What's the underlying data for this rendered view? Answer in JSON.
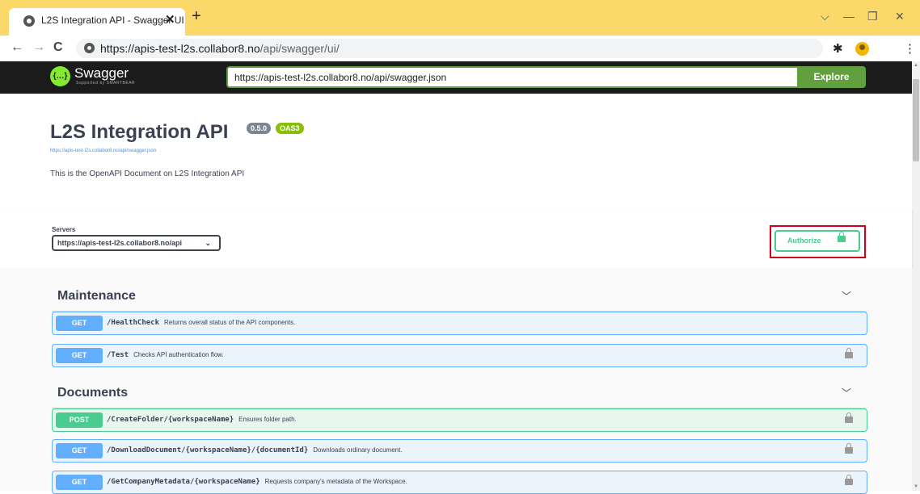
{
  "browser": {
    "tab_title": "L2S Integration API - Swagger UI",
    "tab_close": "✕",
    "new_tab": "+",
    "url_host": "https://apis-test-l2s.collabor8.no",
    "url_path": "/api/swagger/ui/",
    "back": "←",
    "forward": "→",
    "reload": "C",
    "window_dropdown": "⌵",
    "minimize": "—",
    "restore": "❐",
    "close": "✕",
    "extensions": "✱",
    "sidepanel": "◧",
    "menu": "⋮"
  },
  "topbar": {
    "logo_mark": "{…}",
    "logo_text": "Swagger",
    "logo_sub": "Supported by SMARTBEAR",
    "spec_url": "https://apis-test-l2s.collabor8.no/api/swagger.json",
    "explore_label": "Explore"
  },
  "info": {
    "title": "L2S Integration API",
    "version": "0.5.0",
    "oas": "OAS3",
    "link": "https://apis-test-l2s.collabor8.no/api/swagger.json",
    "description": "This is the OpenAPI Document on L2S Integration API"
  },
  "scheme": {
    "servers_label": "Servers",
    "selected_server": "https://apis-test-l2s.collabor8.no/api",
    "authorize_label": "Authorize"
  },
  "tags": [
    {
      "name": "Maintenance",
      "operations": [
        {
          "method": "GET",
          "path": "/HealthCheck",
          "summary": "Returns overall status of the API components.",
          "locked": false
        },
        {
          "method": "GET",
          "path": "/Test",
          "summary": "Checks API authentication flow.",
          "locked": true
        }
      ]
    },
    {
      "name": "Documents",
      "operations": [
        {
          "method": "POST",
          "path": "/CreateFolder/{workspaceName}",
          "summary": "Ensures folder path.",
          "locked": true
        },
        {
          "method": "GET",
          "path": "/DownloadDocument/{workspaceName}/{documentId}",
          "summary": "Downloads ordinary document.",
          "locked": true
        },
        {
          "method": "GET",
          "path": "/GetCompanyMetadata/{workspaceName}",
          "summary": "Requests company's metadata of the Workspace.",
          "locked": true
        }
      ]
    }
  ],
  "colors": {
    "get": "#61affe",
    "post": "#49cc90",
    "explore": "#62a03f",
    "highlight": "#d0021b"
  }
}
